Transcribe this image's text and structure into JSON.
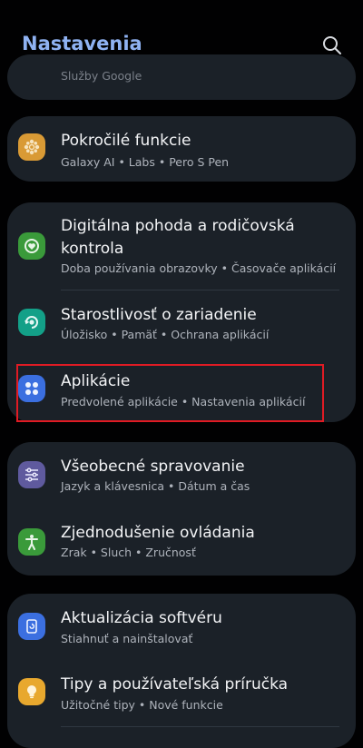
{
  "header": {
    "title": "Nastavenia"
  },
  "top_partial": {
    "subtitle": "Služby Google"
  },
  "cards": [
    {
      "rows": [
        {
          "title": "Pokročilé funkcie",
          "subtitle": "Galaxy AI  •  Labs  •  Pero S Pen",
          "icon": "advanced-features-icon",
          "color": "#d99a35"
        }
      ]
    },
    {
      "rows": [
        {
          "title": "Digitálna pohoda a rodičovská kontrola",
          "subtitle": "Doba používania obrazovky  •  Časovače aplikácií",
          "icon": "digital-wellbeing-icon",
          "color": "#3a9a3a"
        },
        {
          "title": "Starostlivosť o zariadenie",
          "subtitle": "Úložisko  •  Pamäť  •  Ochrana aplikácií",
          "icon": "device-care-icon",
          "color": "#13a088"
        },
        {
          "title": "Aplikácie",
          "subtitle": "Predvolené aplikácie  •  Nastavenia aplikácií",
          "icon": "apps-icon",
          "color": "#3b6fe0"
        }
      ]
    },
    {
      "rows": [
        {
          "title": "Všeobecné spravovanie",
          "subtitle": "Jazyk a klávesnica  •  Dátum a čas",
          "icon": "general-management-icon",
          "color": "#5f5a9e"
        },
        {
          "title": "Zjednodušenie ovládania",
          "subtitle": "Zrak  •  Sluch  •  Zručnosť",
          "icon": "accessibility-icon",
          "color": "#3a9a3a"
        }
      ]
    },
    {
      "rows": [
        {
          "title": "Aktualizácia softvéru",
          "subtitle": "Stiahnuť a nainštalovať",
          "icon": "software-update-icon",
          "color": "#3b6fe0"
        },
        {
          "title": "Tipy a používateľská príručka",
          "subtitle": "Užitočné tipy  •  Nové funkcie",
          "icon": "tips-icon",
          "color": "#e8a82e"
        }
      ]
    }
  ],
  "colors": {
    "accent": "#8fb2f2",
    "highlight_border": "#e01b24",
    "card_bg": "#1b2128"
  }
}
